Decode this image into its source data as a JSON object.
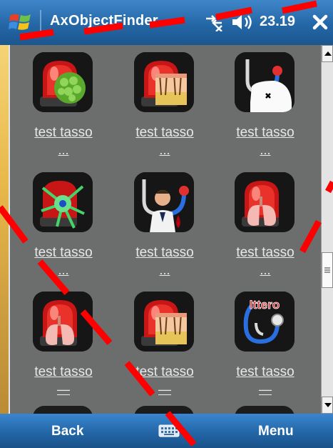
{
  "titlebar": {
    "app_title": "AxObjectFinder",
    "clock": "23.19",
    "icons": [
      "windows-start-icon",
      "connectivity-off-icon",
      "volume-icon",
      "close-icon"
    ]
  },
  "items": [
    {
      "label": "test tasso",
      "more": "...",
      "icon": "alarm-virus-icon"
    },
    {
      "label": "test tasso",
      "more": "...",
      "icon": "alarm-skin-icon"
    },
    {
      "label": "test tasso",
      "more": "...",
      "icon": "stethoscope-chest-icon"
    },
    {
      "label": "test tasso",
      "more": "...",
      "icon": "alarm-neuron-icon"
    },
    {
      "label": "test tasso",
      "more": "...",
      "icon": "stethoscope-doctor-icon"
    },
    {
      "label": "test tasso",
      "more": "...",
      "icon": "alarm-lungs-icon"
    },
    {
      "label": "test tasso",
      "more": "—",
      "icon": "alarm-lungs-icon"
    },
    {
      "label": "test tasso",
      "more": "—",
      "icon": "alarm-skin-icon"
    },
    {
      "label": "test tasso",
      "more": "—",
      "icon": "stethoscope-ittero-icon"
    }
  ],
  "ittero_badge": "Ittero",
  "softkeys": {
    "left": "Back",
    "right": "Menu",
    "center_icon": "keyboard-icon"
  },
  "colors": {
    "titlebar": "#2467a6",
    "panel": "#6c6d6d",
    "alarm_red": "#d01a1a",
    "overlay_red": "#ff0000"
  }
}
